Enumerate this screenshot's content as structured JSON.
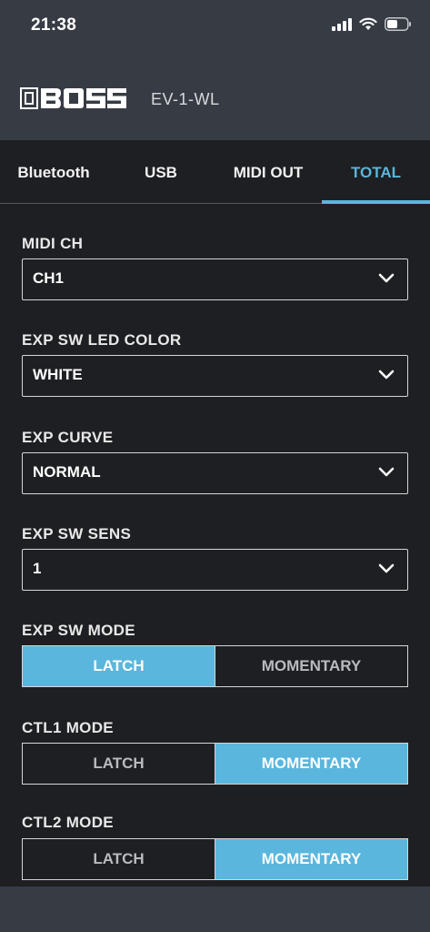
{
  "status_bar": {
    "time": "21:38",
    "icons": [
      "cellular-signal-icon",
      "wifi-icon",
      "battery-icon"
    ]
  },
  "app_bar": {
    "logo_text": "BOSS",
    "device_name": "EV-1-WL"
  },
  "tabs": [
    {
      "label": "Bluetooth",
      "active": false
    },
    {
      "label": "USB",
      "active": false
    },
    {
      "label": "MIDI OUT",
      "active": false
    },
    {
      "label": "TOTAL",
      "active": true
    }
  ],
  "settings": {
    "midi_ch": {
      "label": "MIDI CH",
      "value": "CH1"
    },
    "exp_sw_led_color": {
      "label": "EXP SW LED COLOR",
      "value": "WHITE"
    },
    "exp_curve": {
      "label": "EXP CURVE",
      "value": "NORMAL"
    },
    "exp_sw_sens": {
      "label": "EXP SW SENS",
      "value": "1"
    },
    "exp_sw_mode": {
      "label": "EXP SW MODE",
      "options": [
        "LATCH",
        "MOMENTARY"
      ],
      "selected": "LATCH"
    },
    "ctl1_mode": {
      "label": "CTL1 MODE",
      "options": [
        "LATCH",
        "MOMENTARY"
      ],
      "selected": "MOMENTARY"
    },
    "ctl2_mode": {
      "label": "CTL2 MODE",
      "options": [
        "LATCH",
        "MOMENTARY"
      ],
      "selected": "MOMENTARY"
    }
  },
  "colors": {
    "accent": "#5ab6dc",
    "header_bg": "#363b44",
    "content_bg": "#1e1f22"
  }
}
